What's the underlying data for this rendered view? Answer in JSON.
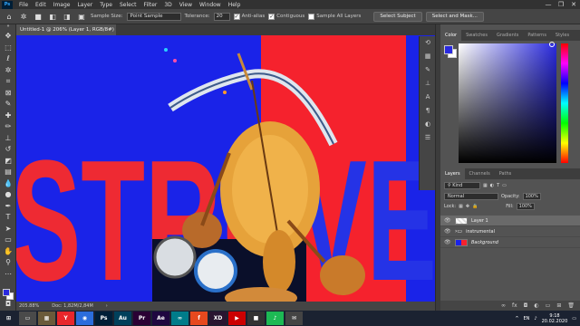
{
  "app": {
    "logo": "Ps"
  },
  "menu": [
    "File",
    "Edit",
    "Image",
    "Layer",
    "Type",
    "Select",
    "Filter",
    "3D",
    "View",
    "Window",
    "Help"
  ],
  "window_controls": [
    "—",
    "❐",
    "✕"
  ],
  "options": {
    "sample_size_label": "Sample Size:",
    "sample_size_value": "Point Sample",
    "tolerance_label": "Tolerance:",
    "tolerance_value": "20",
    "anti_alias_label": "Anti-alias",
    "contiguous_label": "Contiguous",
    "sample_all_layers_label": "Sample All Layers",
    "select_subject_label": "Select Subject",
    "select_and_mask_label": "Select and Mask..."
  },
  "document": {
    "tab_title": "Untitled-1 @ 206% (Layer 1, RGB/8#) *",
    "canvas_text": "STRUVE",
    "colors": {
      "bg_blue": "#1a23e8",
      "bg_red": "#f5222d",
      "text_red": "#ee2a33",
      "text_blue": "#2533e6"
    }
  },
  "status": {
    "zoom": "205.88%",
    "doc": "Doc: 1,82M/2,84M"
  },
  "color_panel": {
    "tabs": [
      "Color",
      "Swatches",
      "Gradients",
      "Patterns",
      "Styles"
    ],
    "active_tab": "Color",
    "foreground": "#2a2adf",
    "background": "#ffffff"
  },
  "layers_panel": {
    "tabs": [
      "Layers",
      "Channels",
      "Paths"
    ],
    "active_tab": "Layers",
    "kind_label": "Kind",
    "blend_mode": "Normal",
    "opacity_label": "Opacity:",
    "opacity_value": "100%",
    "lock_label": "Lock:",
    "fill_label": "Fill:",
    "fill_value": "100%",
    "layers": [
      {
        "name": "Layer 1",
        "selected": true
      },
      {
        "name": "instrumental",
        "selected": false
      },
      {
        "name": "Background",
        "selected": false
      }
    ]
  },
  "taskbar": {
    "apps": [
      {
        "name": "⊞",
        "color": "#1b2231"
      },
      {
        "name": "▭",
        "color": "#4a4a4a"
      },
      {
        "name": "▦",
        "color": "#6a5a3a"
      },
      {
        "name": "Y",
        "color": "#e8262b"
      },
      {
        "name": "◉",
        "color": "#2b6ddc"
      },
      {
        "name": "Ps",
        "color": "#001e36"
      },
      {
        "name": "Au",
        "color": "#00405b"
      },
      {
        "name": "Pr",
        "color": "#2a0034"
      },
      {
        "name": "Ae",
        "color": "#1f0740"
      },
      {
        "name": "∞",
        "color": "#007c8a"
      },
      {
        "name": "f",
        "color": "#e6491e"
      },
      {
        "name": "XD",
        "color": "#2a1530"
      },
      {
        "name": "▶",
        "color": "#c00"
      },
      {
        "name": "■",
        "color": "#333"
      },
      {
        "name": "♪",
        "color": "#1db954"
      },
      {
        "name": "✉",
        "color": "#444"
      }
    ],
    "lang": "EN",
    "time": "9:18",
    "date": "20.02.2020"
  }
}
